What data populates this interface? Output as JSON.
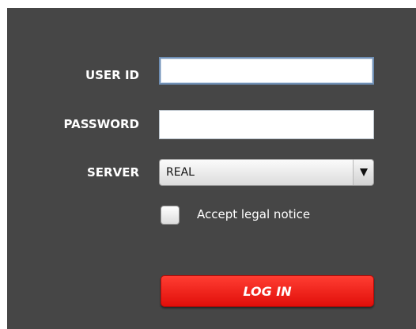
{
  "login_form": {
    "user_id_label": "USER ID",
    "user_id_value": "",
    "password_label": "PASSWORD",
    "password_value": "",
    "server_label": "SERVER",
    "server_selected": "REAL",
    "accept_label": "Accept legal notice",
    "accept_checked": false,
    "login_button_label": "LOG IN"
  },
  "colors": {
    "panel_bg": "#464646",
    "login_button": "#f21b12"
  },
  "icons": {
    "dropdown": "caret-down-icon"
  }
}
